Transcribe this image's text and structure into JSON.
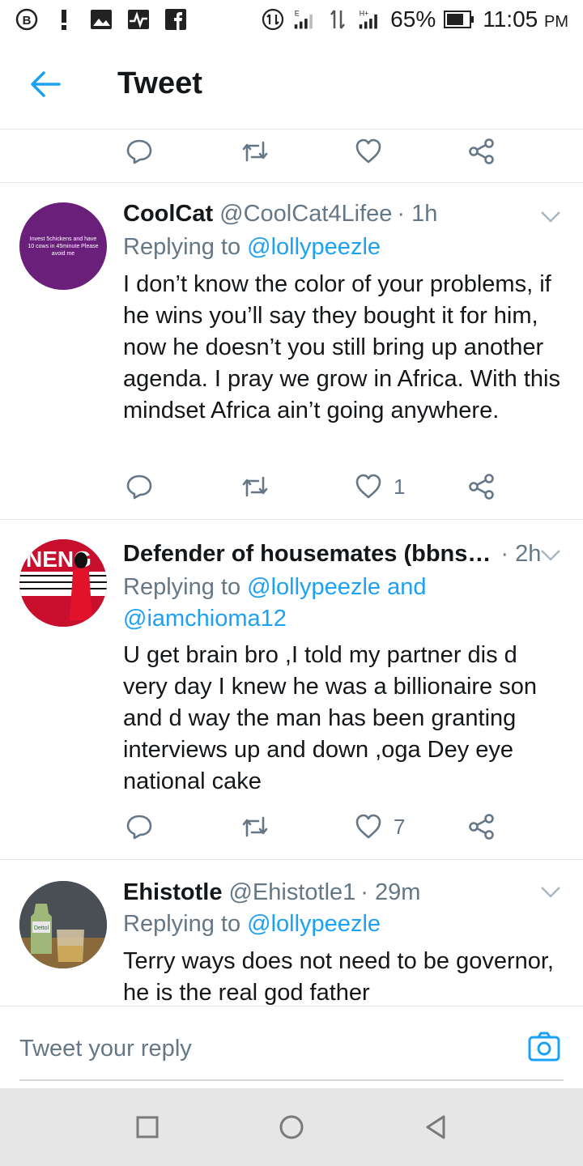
{
  "status_bar": {
    "battery": "65%",
    "time": "11:05",
    "ampm": "PM",
    "network_e": "E",
    "network_h": "H+"
  },
  "header": {
    "title": "Tweet"
  },
  "tweets": [
    {
      "name": "CoolCat",
      "handle": "@CoolCat4Lifee",
      "time": "· 1h",
      "replying_prefix": "Replying to",
      "replying_to": "@lollypeezle",
      "replying_to_2": "",
      "body": "I don’t know the color of your problems, if he wins you’ll say they bought it for him, now he doesn’t you still bring up another agenda. I pray we grow in Africa. With this mindset Africa ain’t going anywhere.",
      "like_count": "1",
      "avatar_text": "Invest 5chickens and have 10 cows in 45minute Please avoid me",
      "avatar_color": "#6a1f7a"
    },
    {
      "name": "Defender of housemates (bbns…",
      "handle": "",
      "time": "· 2h",
      "replying_prefix": "Replying to",
      "replying_to": "@lollypeezle and",
      "replying_to_2": "@iamchioma12",
      "body": "U get brain bro ,I told my partner dis d very day I knew he was a billionaire son and d way the man has been granting interviews up and down ,oga Dey eye national cake",
      "like_count": "7",
      "avatar_text": "NENG",
      "avatar_color": "#c8102e"
    },
    {
      "name": "Ehistotle",
      "handle": "@Ehistotle1",
      "time": "· 29m",
      "replying_prefix": "Replying to",
      "replying_to": "@lollypeezle",
      "replying_to_2": "",
      "body": "Terry ways does not need to be governor, he is the real god father",
      "like_count": "",
      "avatar_text": "Dettol",
      "avatar_color": "#3a3f44"
    }
  ],
  "reply_bar": {
    "placeholder": "Tweet your reply"
  },
  "colors": {
    "accent": "#1da1f2",
    "secondary_text": "#657786",
    "divider": "#e1e8ed"
  },
  "icons": [
    "back-arrow-icon",
    "reply-icon",
    "retweet-icon",
    "like-icon",
    "share-icon",
    "chevron-down-icon",
    "camera-icon"
  ]
}
